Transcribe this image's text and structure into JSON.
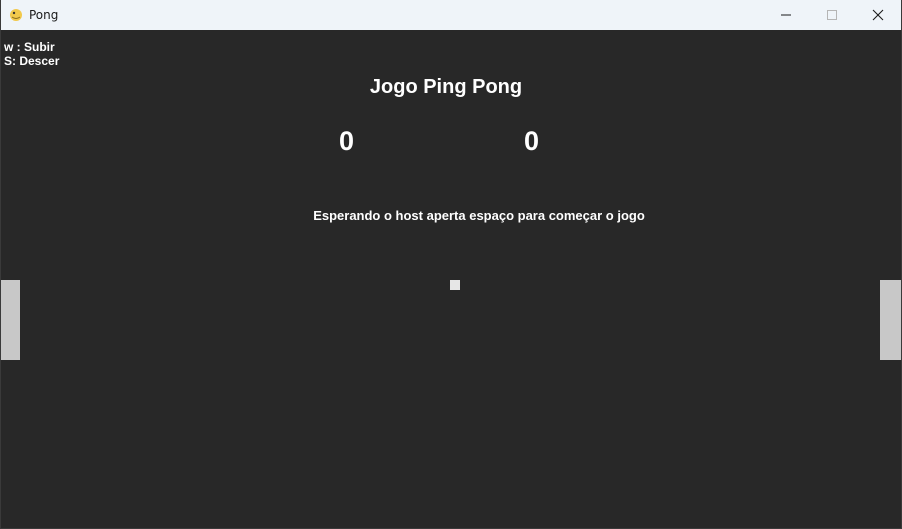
{
  "window": {
    "title": "Pong",
    "app_icon": "python-snake-icon",
    "controls": [
      "minimize-icon",
      "maximize-icon",
      "close-icon"
    ]
  },
  "game": {
    "instructions": {
      "up": "w : Subir",
      "down": "S: Descer"
    },
    "heading": "Jogo Ping Pong",
    "score_left": "0",
    "score_right": "0",
    "status": "Esperando o host aperta espaço para começar o jogo",
    "colors": {
      "background": "#282828",
      "paddle": "#c8c8c8",
      "ball": "#e6e6e6",
      "text": "#ffffff"
    }
  }
}
